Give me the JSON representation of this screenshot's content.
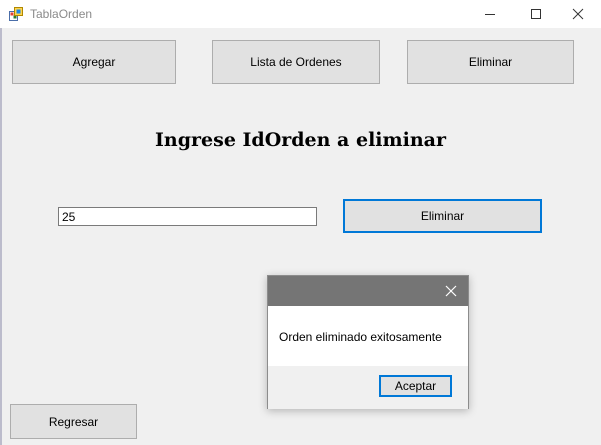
{
  "window": {
    "title": "TablaOrden"
  },
  "toolbar": {
    "agregar_label": "Agregar",
    "lista_label": "Lista de Ordenes",
    "eliminar_label": "Eliminar"
  },
  "main": {
    "heading": "Ingrese IdOrden a eliminar",
    "id_value": "25",
    "eliminar_label": "Eliminar",
    "regresar_label": "Regresar"
  },
  "dialog": {
    "message": "Orden eliminado exitosamente",
    "accept_label": "Aceptar"
  },
  "colors": {
    "accent": "#0078d7",
    "dialog_titlebar": "#757575",
    "background": "#f0f0f0"
  }
}
